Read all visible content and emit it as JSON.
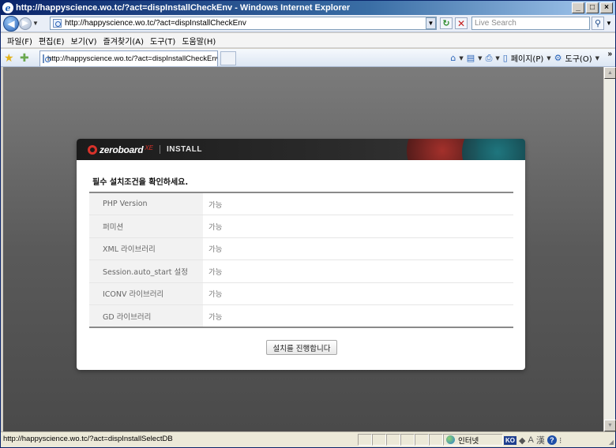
{
  "window": {
    "title": "http://happyscience.wo.tc/?act=dispInstallCheckEnv - Windows Internet Explorer",
    "controls": {
      "minimize": "_",
      "maximize": "□",
      "close": "×"
    }
  },
  "address_bar": {
    "url": "http://happyscience.wo.tc/?act=dispInstallCheckEnv",
    "search_placeholder": "Live Search"
  },
  "menu": {
    "items": [
      "파일(F)",
      "편집(E)",
      "보기(V)",
      "즐겨찾기(A)",
      "도구(T)",
      "도움말(H)"
    ]
  },
  "tabs": {
    "active_tab_label": "http://happyscience.wo.tc/?act=dispInstallCheckEnv"
  },
  "command_bar": {
    "page_label": "페이지(P)",
    "tools_label": "도구(O)"
  },
  "install": {
    "logo_text": "zeroboard",
    "logo_suffix": "XE",
    "section_label": "INSTALL",
    "heading": "필수 설치조건을 확인하세요.",
    "checks": [
      {
        "label": "PHP Version",
        "status": "가능"
      },
      {
        "label": "퍼미션",
        "status": "가능"
      },
      {
        "label": "XML 라이브러리",
        "status": "가능"
      },
      {
        "label": "Session.auto_start 설정",
        "status": "가능"
      },
      {
        "label": "ICONV 라이브러리",
        "status": "가능"
      },
      {
        "label": "GD 라이브러리",
        "status": "가능"
      }
    ],
    "proceed_button": "설치를 진행합니다"
  },
  "status_bar": {
    "text": "http://happyscience.wo.tc/?act=dispInstallSelectDB",
    "zone": "인터넷",
    "ime_lang": "KO"
  },
  "colors": {
    "title_bar": "#0a246a",
    "content_background": "#5a5a5a",
    "accent_red": "#d8322a"
  }
}
